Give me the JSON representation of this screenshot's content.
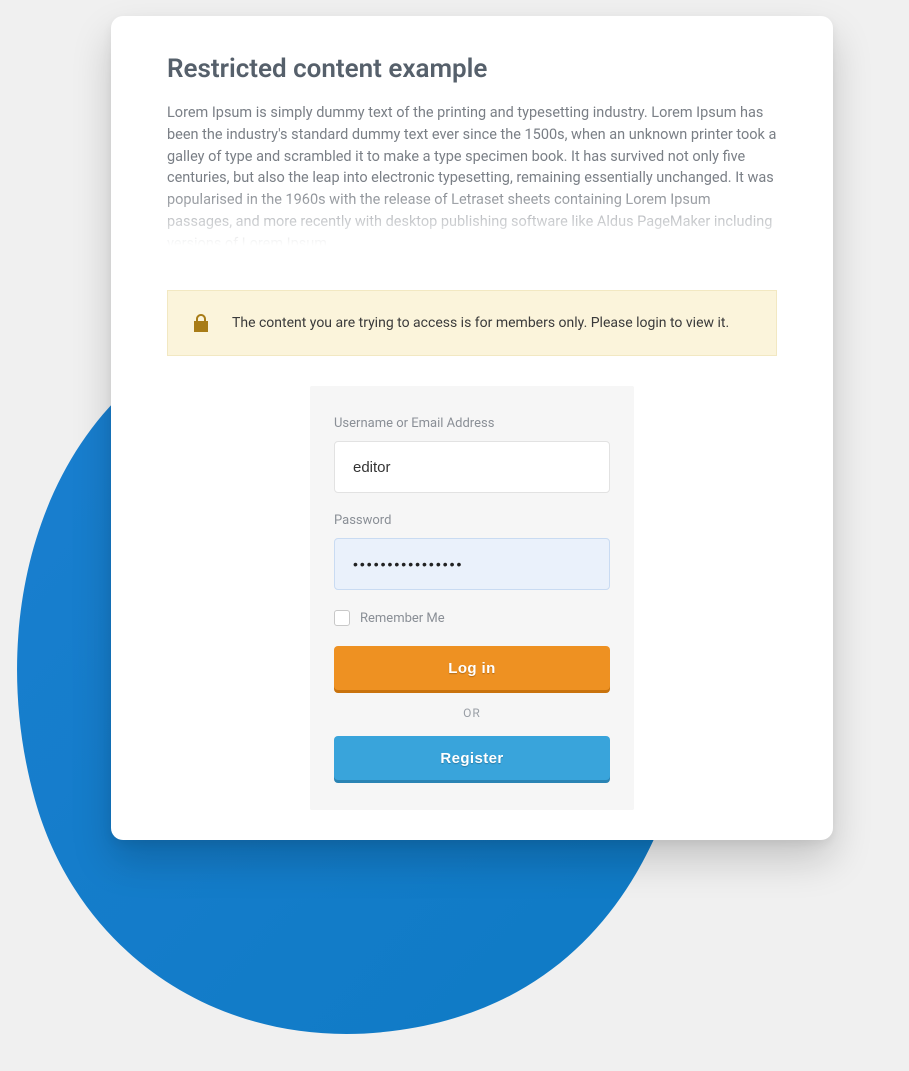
{
  "header": {
    "title": "Restricted content example",
    "description": "Lorem Ipsum is simply dummy text of the printing and typesetting industry. Lorem Ipsum has been the industry's standard dummy text ever since the 1500s, when an unknown printer took a galley of type and scrambled it to make a type specimen book. It has survived not only five centuries, but also the leap into electronic typesetting, remaining essentially unchanged. It was popularised in the 1960s with the release of Letraset sheets containing Lorem Ipsum passages, and more recently with desktop publishing software like Aldus PageMaker including versions of Lorem Ipsum."
  },
  "notice": {
    "text": "The content you are trying to access is for members only. Please login to view it."
  },
  "form": {
    "username_label": "Username or Email Address",
    "username_value": "editor",
    "password_label": "Password",
    "password_value": "••••••••••••••••",
    "remember_label": "Remember Me",
    "login_label": "Log in",
    "or_label": "OR",
    "register_label": "Register"
  },
  "colors": {
    "accent_blue": "#0e7ac4",
    "notice_bg": "#fbf4db",
    "login_btn": "#ee9122",
    "register_btn": "#39a4db"
  }
}
